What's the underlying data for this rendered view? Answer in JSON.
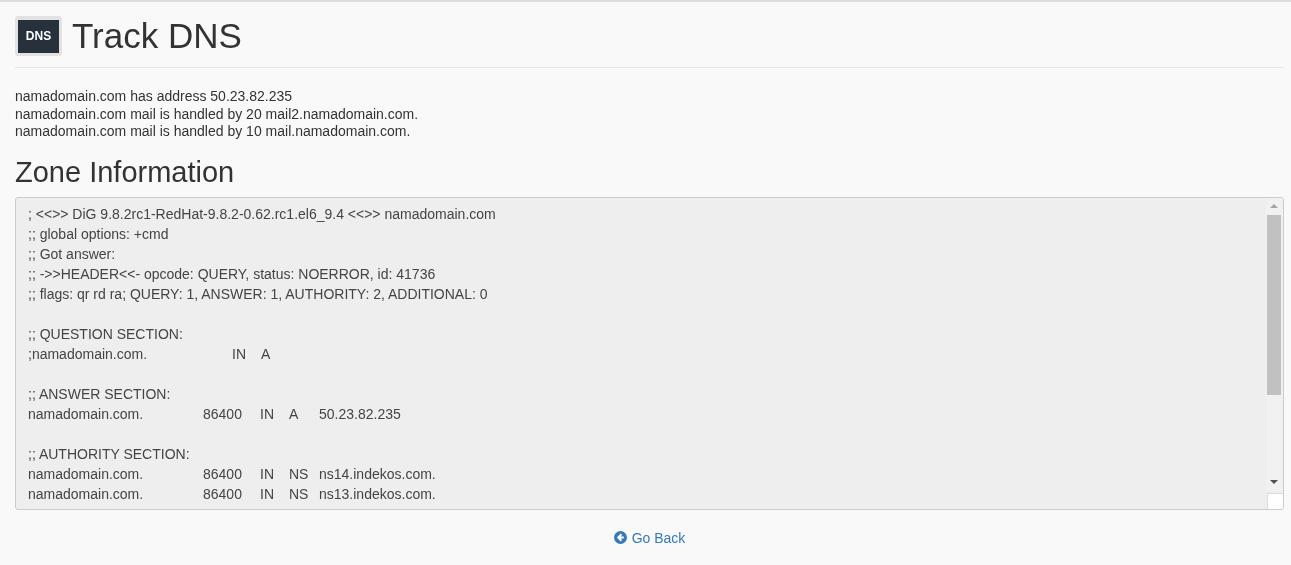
{
  "header": {
    "icon_label": "DNS",
    "title": "Track DNS"
  },
  "summary": [
    "namadomain.com has address 50.23.82.235",
    "namadomain.com mail is handled by 20 mail2.namadomain.com.",
    "namadomain.com mail is handled by 10 mail.namadomain.com."
  ],
  "zone": {
    "title": "Zone Information",
    "lines": [
      {
        "kind": "text",
        "text": "; <<>> DiG 9.8.2rc1-RedHat-9.8.2-0.62.rc1.el6_9.4 <<>> namadomain.com"
      },
      {
        "kind": "text",
        "text": ";; global options: +cmd"
      },
      {
        "kind": "text",
        "text": ";; Got answer:"
      },
      {
        "kind": "text",
        "text": ";; ->>HEADER<<- opcode: QUERY, status: NOERROR, id: 41736"
      },
      {
        "kind": "text",
        "text": ";; flags: qr rd ra; QUERY: 1, ANSWER: 1, AUTHORITY: 2, ADDITIONAL: 0"
      },
      {
        "kind": "blank"
      },
      {
        "kind": "text",
        "text": ";; QUESTION SECTION:"
      },
      {
        "kind": "question",
        "cells": [
          ";namadomain.com.",
          "IN",
          "A"
        ]
      },
      {
        "kind": "blank"
      },
      {
        "kind": "text",
        "text": ";; ANSWER SECTION:"
      },
      {
        "kind": "record",
        "cells": [
          "namadomain.com.",
          "86400",
          "IN",
          "A",
          "50.23.82.235"
        ]
      },
      {
        "kind": "blank"
      },
      {
        "kind": "text",
        "text": ";; AUTHORITY SECTION:"
      },
      {
        "kind": "record",
        "cells": [
          "namadomain.com.",
          "86400",
          "IN",
          "NS",
          "ns14.indekos.com."
        ]
      },
      {
        "kind": "record",
        "cells": [
          "namadomain.com.",
          "86400",
          "IN",
          "NS",
          "ns13.indekos.com."
        ]
      }
    ]
  },
  "go_back": "Go Back"
}
